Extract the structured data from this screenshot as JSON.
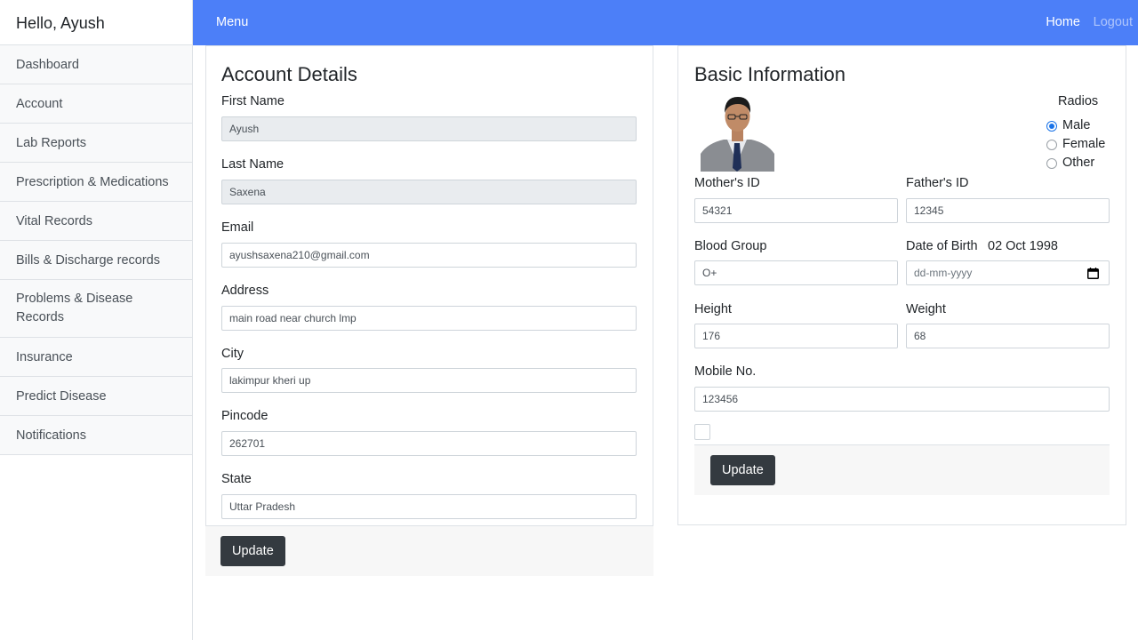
{
  "sidebar": {
    "heading": "Hello, Ayush",
    "items": [
      {
        "label": "Dashboard"
      },
      {
        "label": "Account"
      },
      {
        "label": "Lab Reports"
      },
      {
        "label": "Prescription & Medications"
      },
      {
        "label": "Vital Records"
      },
      {
        "label": "Bills & Discharge records"
      },
      {
        "label": "Problems & Disease Records"
      },
      {
        "label": "Insurance"
      },
      {
        "label": "Predict Disease"
      },
      {
        "label": "Notifications"
      }
    ]
  },
  "navbar": {
    "menu": "Menu",
    "home": "Home",
    "logout": "Logout",
    "color": "#4c7ff8"
  },
  "account": {
    "title": "Account Details",
    "first_name": {
      "label": "First Name",
      "value": "Ayush"
    },
    "last_name": {
      "label": "Last Name",
      "value": "Saxena"
    },
    "email": {
      "label": "Email",
      "value": "ayushsaxena210@gmail.com"
    },
    "address": {
      "label": "Address",
      "value": "main road near church lmp"
    },
    "city": {
      "label": "City",
      "value": "lakimpur kheri up"
    },
    "pincode": {
      "label": "Pincode",
      "value": "262701"
    },
    "state": {
      "label": "State",
      "value": "Uttar Pradesh"
    },
    "update_label": "Update"
  },
  "basic": {
    "title": "Basic Information",
    "radios_label": "Radios",
    "gender_options": [
      "Male",
      "Female",
      "Other"
    ],
    "gender_selected": "Male",
    "mothers_id": {
      "label": "Mother's ID",
      "value": "54321"
    },
    "fathers_id": {
      "label": "Father's ID",
      "value": "12345"
    },
    "blood_group": {
      "label": "Blood Group",
      "value": "O+"
    },
    "dob": {
      "label": "Date of Birth",
      "display": "02 Oct 1998",
      "placeholder": "dd-mm-yyyy"
    },
    "height": {
      "label": "Height",
      "value": "176"
    },
    "weight": {
      "label": "Weight",
      "value": "68"
    },
    "mobile": {
      "label": "Mobile No.",
      "value": "123456"
    },
    "update_label": "Update"
  }
}
